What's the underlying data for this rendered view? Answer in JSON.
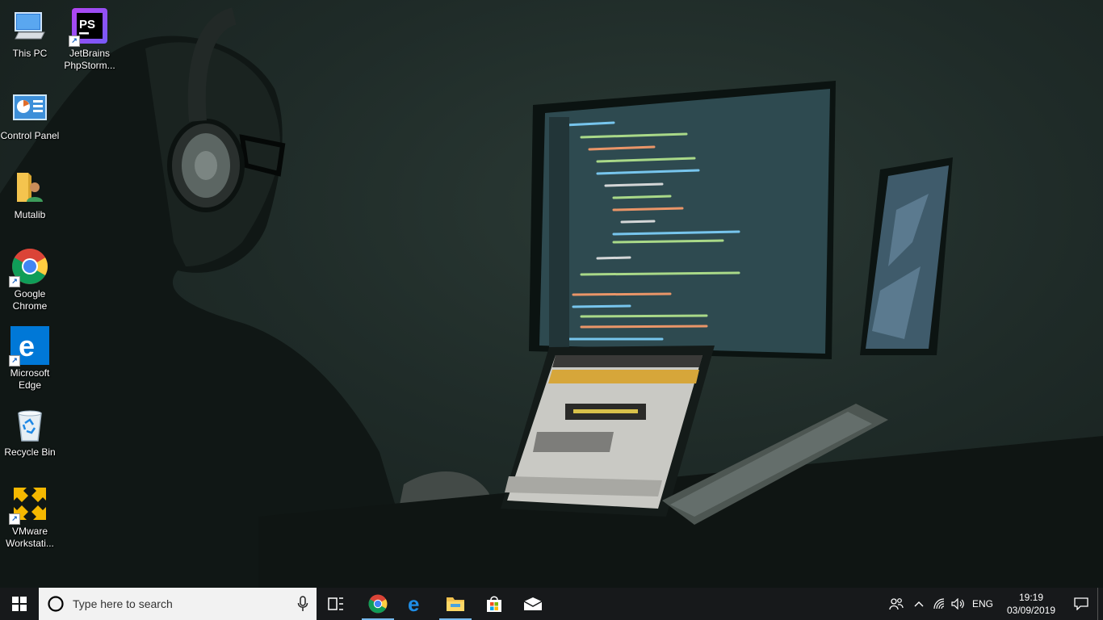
{
  "desktop": {
    "icons": [
      {
        "label": "This PC",
        "icon": "computer-icon",
        "shortcut": false
      },
      {
        "label": "JetBrains PhpStorm...",
        "icon": "phpstorm-icon",
        "shortcut": true
      },
      {
        "label": "Control Panel",
        "icon": "control-panel-icon",
        "shortcut": false
      },
      {
        "label": "Mutalib",
        "icon": "user-folder-icon",
        "shortcut": false
      },
      {
        "label": "Google Chrome",
        "icon": "chrome-icon",
        "shortcut": true
      },
      {
        "label": "Microsoft Edge",
        "icon": "edge-icon",
        "shortcut": true
      },
      {
        "label": "Recycle Bin",
        "icon": "recycle-bin-icon",
        "shortcut": false
      },
      {
        "label": "VMware Workstati...",
        "icon": "vmware-icon",
        "shortcut": true
      }
    ]
  },
  "taskbar": {
    "search_placeholder": "Type here to search",
    "apps": [
      {
        "name": "Task View",
        "icon": "task-view-icon",
        "active": false
      },
      {
        "name": "Google Chrome",
        "icon": "chrome-icon",
        "active": true
      },
      {
        "name": "Microsoft Edge",
        "icon": "edge-icon",
        "active": false
      },
      {
        "name": "File Explorer",
        "icon": "folder-icon",
        "active": true
      },
      {
        "name": "Microsoft Store",
        "icon": "store-icon",
        "active": false
      },
      {
        "name": "Mail",
        "icon": "mail-icon",
        "active": false
      }
    ],
    "tray": {
      "language": "ENG",
      "time": "19:19",
      "date": "03/09/2019"
    }
  },
  "colors": {
    "taskbar_bg": "#17191b",
    "search_bg": "#f2f2f2",
    "active_indicator": "#76b9ed",
    "windows_blue": "#0078d7"
  }
}
